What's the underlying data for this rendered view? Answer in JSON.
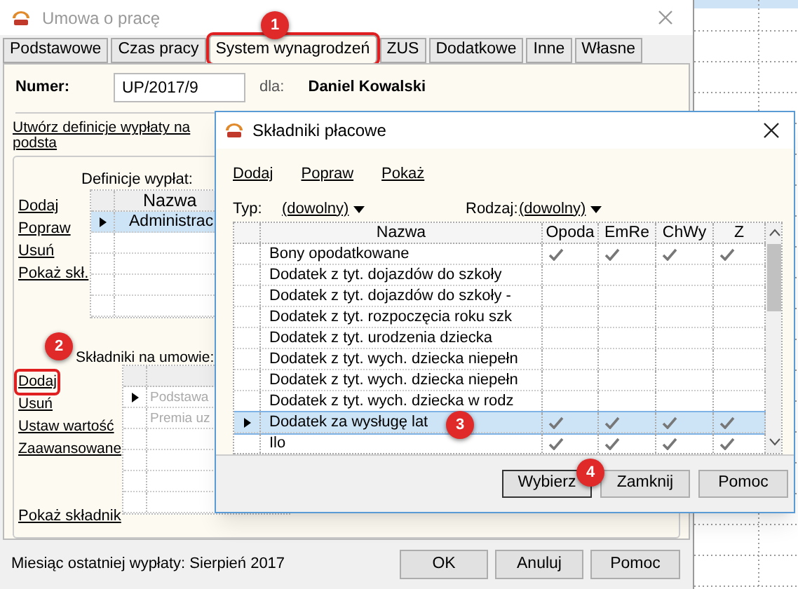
{
  "window": {
    "title": "Umowa o pracę"
  },
  "tabs": [
    {
      "label": "Podstawowe",
      "selected": false,
      "highlighted": false
    },
    {
      "label": "Czas pracy",
      "selected": false,
      "highlighted": false
    },
    {
      "label": "System wynagrodzeń",
      "selected": true,
      "highlighted": true
    },
    {
      "label": "ZUS",
      "selected": false,
      "highlighted": false
    },
    {
      "label": "Dodatkowe",
      "selected": false,
      "highlighted": false
    },
    {
      "label": "Inne",
      "selected": false,
      "highlighted": false
    },
    {
      "label": "Własne",
      "selected": false,
      "highlighted": false
    }
  ],
  "number": {
    "label": "Numer:",
    "value": "UP/2017/9",
    "for_label": "dla:",
    "employee": "Daniel Kowalski"
  },
  "create_link": "Utwórz definicje wypłaty na podsta",
  "definitions": {
    "label": "Definicje wypłat:",
    "links": [
      {
        "label": "Dodaj",
        "highlighted": false
      },
      {
        "label": "Popraw",
        "highlighted": false
      },
      {
        "label": "Usuń",
        "highlighted": false
      },
      {
        "label": "Pokaż skł.",
        "highlighted": false
      }
    ],
    "column": "Nazwa",
    "rows": [
      {
        "name": "Administrac",
        "selected": true
      }
    ]
  },
  "components": {
    "label": "Składniki na umowie:",
    "links": [
      {
        "label": "Dodaj",
        "highlighted": true
      },
      {
        "label": "Usuń",
        "highlighted": false
      },
      {
        "label": "Ustaw wartość",
        "highlighted": false
      },
      {
        "label": "Zaawansowane",
        "highlighted": false
      }
    ],
    "rows": [
      {
        "name": "Podstawa",
        "selected": true
      },
      {
        "name": "Premia uz",
        "selected": false
      }
    ],
    "show_link": "Pokaż składnik"
  },
  "status": "Miesiąc ostatniej wypłaty: Sierpień 2017",
  "buttons": [
    "OK",
    "Anuluj",
    "Pomoc"
  ],
  "dialog": {
    "title": "Składniki płacowe",
    "links": [
      "Dodaj",
      "Popraw",
      "Pokaż"
    ],
    "filters": [
      {
        "label": "Typ:",
        "value": "(dowolny)"
      },
      {
        "label": "Rodzaj:",
        "value": "(dowolny)"
      }
    ],
    "columns": [
      "Nazwa",
      "Opoda",
      "EmRe",
      "ChWy",
      "Z"
    ],
    "rows": [
      {
        "name": "Bony opodatkowane",
        "selected": false,
        "checks": [
          true,
          true,
          true,
          true
        ]
      },
      {
        "name": "Dodatek z tyt. dojazdów do szkoły",
        "selected": false,
        "checks": [
          false,
          false,
          false,
          false
        ]
      },
      {
        "name": "Dodatek z tyt. dojazdów do szkoły -",
        "selected": false,
        "checks": [
          false,
          false,
          false,
          false
        ]
      },
      {
        "name": "Dodatek z tyt. rozpoczęcia roku szk",
        "selected": false,
        "checks": [
          false,
          false,
          false,
          false
        ]
      },
      {
        "name": "Dodatek z tyt. urodzenia dziecka",
        "selected": false,
        "checks": [
          false,
          false,
          false,
          false
        ]
      },
      {
        "name": "Dodatek z tyt. wych. dziecka niepełn",
        "selected": false,
        "checks": [
          false,
          false,
          false,
          false
        ]
      },
      {
        "name": "Dodatek z tyt. wych. dziecka niepełn",
        "selected": false,
        "checks": [
          false,
          false,
          false,
          false
        ]
      },
      {
        "name": "Dodatek z tyt. wych. dziecka w rodz",
        "selected": false,
        "checks": [
          false,
          false,
          false,
          false
        ]
      },
      {
        "name": "Dodatek za wysługę lat",
        "selected": true,
        "checks": [
          true,
          true,
          true,
          true
        ]
      },
      {
        "name": "Ilo",
        "selected": false,
        "checks": [
          true,
          true,
          true,
          true
        ]
      }
    ],
    "buttons": [
      "Wybierz",
      "Zamknij",
      "Pomoc"
    ]
  },
  "callouts": [
    "1",
    "2",
    "3",
    "4"
  ]
}
